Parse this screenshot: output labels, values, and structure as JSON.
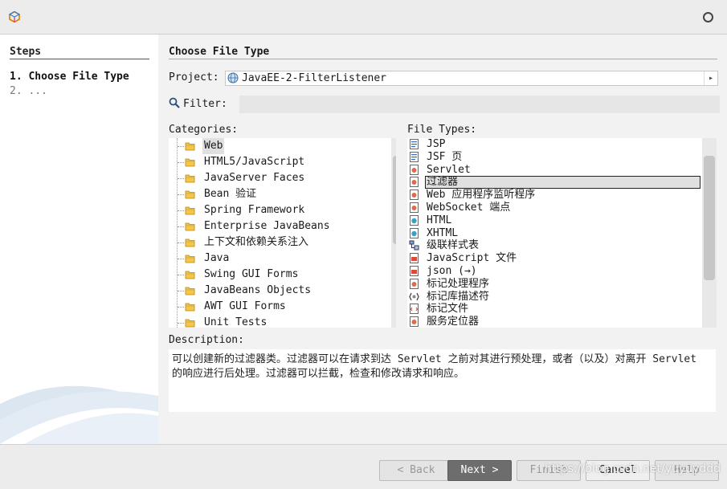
{
  "window": {
    "logo_icon": "netbeans-logo-icon",
    "close_icon": "circle-close-icon"
  },
  "steps": {
    "title": "Steps",
    "items": [
      {
        "label": "1. Choose File Type",
        "active": true
      },
      {
        "label": "2. ...",
        "active": false
      }
    ]
  },
  "main": {
    "title": "Choose File Type",
    "project": {
      "label": "Project:",
      "value": "JavaEE-2-FilterListener",
      "dropdown_icon": "dropdown-arrow-icon"
    },
    "filter": {
      "label": "Filter:",
      "value": "",
      "icon": "magnifier-icon"
    },
    "categories": {
      "label": "Categories:",
      "items": [
        {
          "label": "Web",
          "selected": true
        },
        {
          "label": "HTML5/JavaScript"
        },
        {
          "label": "JavaServer Faces"
        },
        {
          "label": "Bean 验证"
        },
        {
          "label": "Spring Framework"
        },
        {
          "label": "Enterprise JavaBeans"
        },
        {
          "label": "上下文和依赖关系注入"
        },
        {
          "label": "Java"
        },
        {
          "label": "Swing GUI Forms"
        },
        {
          "label": "JavaBeans Objects"
        },
        {
          "label": "AWT GUI Forms"
        },
        {
          "label": "Unit Tests"
        }
      ]
    },
    "file_types": {
      "label": "File Types:",
      "items": [
        {
          "label": "JSP",
          "icon": "jsp-file-icon"
        },
        {
          "label": "JSF 页",
          "icon": "jsp-file-icon"
        },
        {
          "label": "Servlet",
          "icon": "class-file-icon"
        },
        {
          "label": "过滤器",
          "icon": "class-file-icon",
          "selected": true
        },
        {
          "label": "Web 应用程序监听程序",
          "icon": "class-file-icon"
        },
        {
          "label": "WebSocket 端点",
          "icon": "class-file-icon"
        },
        {
          "label": "HTML",
          "icon": "html-file-icon"
        },
        {
          "label": "XHTML",
          "icon": "html-file-icon"
        },
        {
          "label": "级联样式表",
          "icon": "css-file-icon"
        },
        {
          "label": "JavaScript 文件",
          "icon": "js-file-icon"
        },
        {
          "label": "json (→)",
          "icon": "json-file-icon"
        },
        {
          "label": "标记处理程序",
          "icon": "class-file-icon"
        },
        {
          "label": "标记库描述符",
          "icon": "tld-file-icon"
        },
        {
          "label": "标记文件",
          "icon": "tag-file-icon"
        },
        {
          "label": "服务定位器",
          "icon": "class-file-icon"
        }
      ]
    },
    "description": {
      "label": "Description:",
      "text": "可以创建新的过滤器类。过滤器可以在请求到达 Servlet 之前对其进行预处理，或者（以及）对离开 Servlet 的响应进行后处理。过滤器可以拦截，检查和修改请求和响应。"
    }
  },
  "buttons": {
    "back": "< Back",
    "next": "Next >",
    "finish": "Finish",
    "cancel": "Cancel",
    "help": "Help"
  },
  "watermark": "https://blog.csdn.net/yuyuyddd"
}
